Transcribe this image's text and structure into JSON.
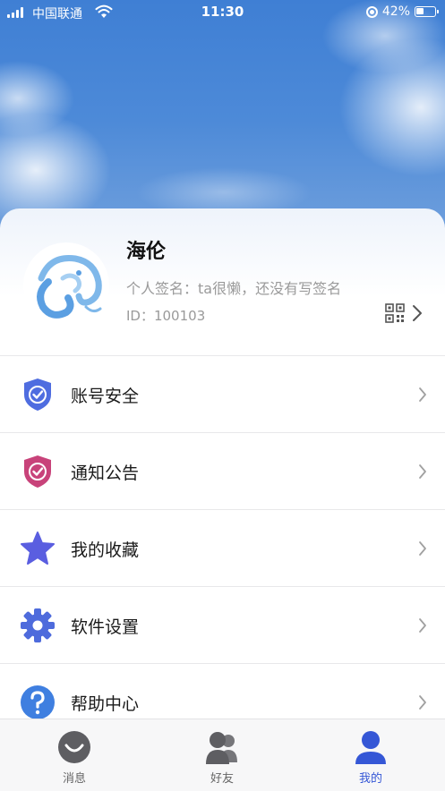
{
  "status_bar": {
    "carrier": "中国联通",
    "time": "11:30",
    "battery": "42%"
  },
  "profile": {
    "name": "海伦",
    "signature": "个人签名：ta很懒，还没有写签名",
    "id": "ID：100103"
  },
  "menu": [
    {
      "label": "账号安全",
      "icon": "shield-check-icon",
      "color": "#4f6de0"
    },
    {
      "label": "通知公告",
      "icon": "notice-shield-icon",
      "color": "#c8437a"
    },
    {
      "label": "我的收藏",
      "icon": "star-icon",
      "color": "#5a5ee0"
    },
    {
      "label": "软件设置",
      "icon": "gear-icon",
      "color": "#4e6bdc"
    },
    {
      "label": "帮助中心",
      "icon": "help-icon",
      "color": "#3f7fe0"
    }
  ],
  "tabs": [
    {
      "label": "消息",
      "icon": "chat-bubble-icon",
      "active": false
    },
    {
      "label": "好友",
      "icon": "friends-icon",
      "active": false
    },
    {
      "label": "我的",
      "icon": "me-icon",
      "active": true
    }
  ],
  "colors": {
    "accent": "#3557d6",
    "sky": "#4d8ad8"
  }
}
